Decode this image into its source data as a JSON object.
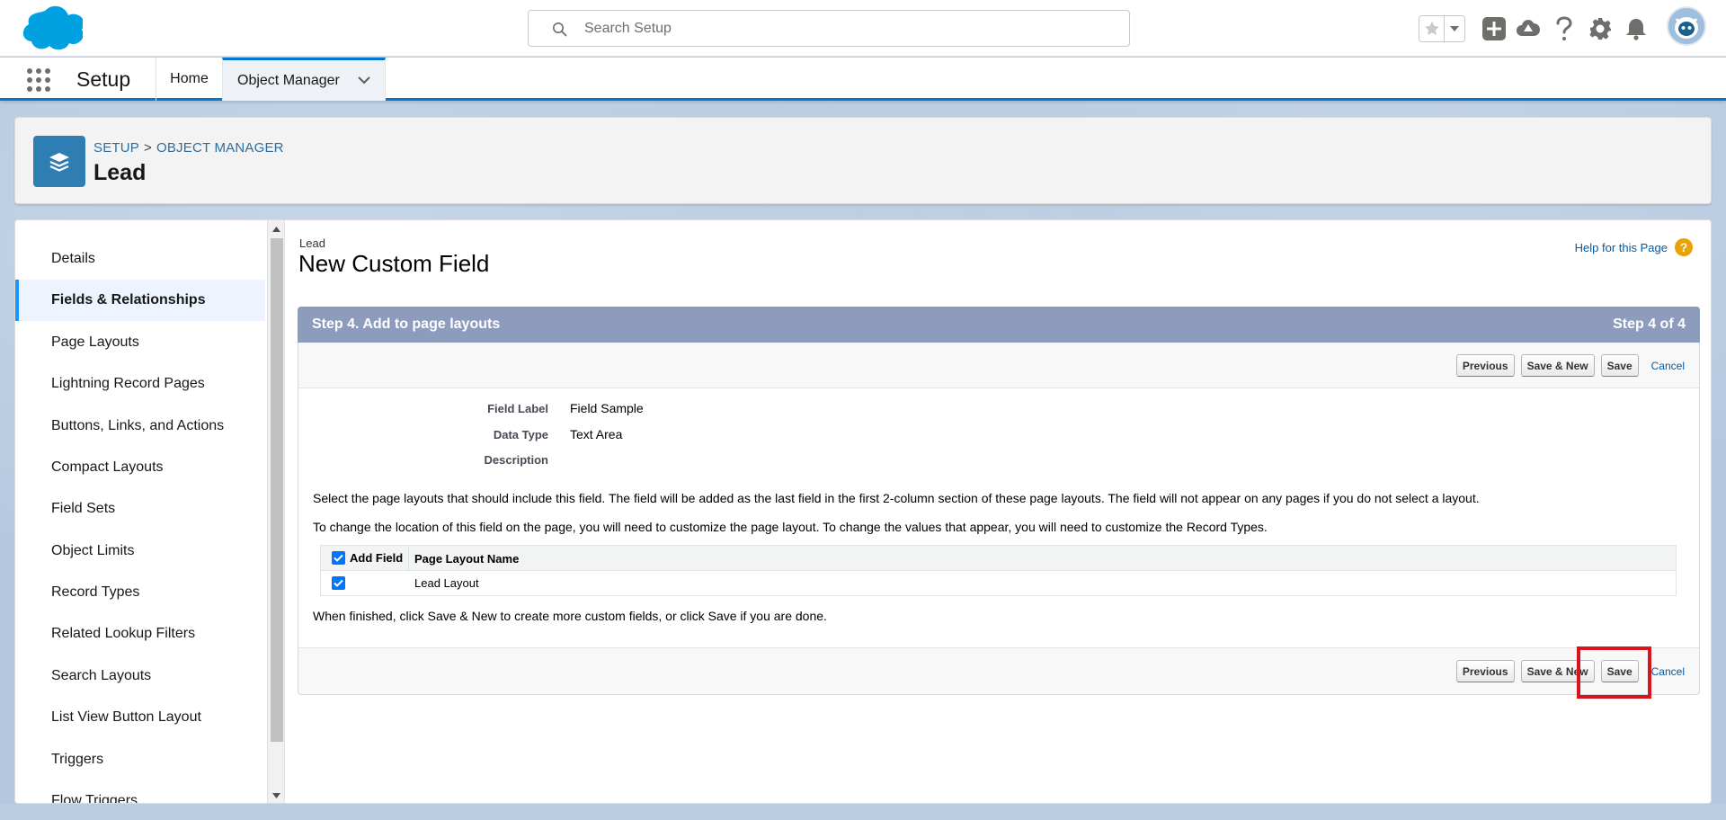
{
  "header": {
    "search_placeholder": "Search Setup"
  },
  "app_nav": {
    "app_name": "Setup",
    "tabs": [
      {
        "label": "Home"
      },
      {
        "label": "Object Manager"
      }
    ]
  },
  "page_header": {
    "breadcrumb": [
      "SETUP",
      "OBJECT MANAGER"
    ],
    "breadcrumb_separator": ">",
    "title": "Lead"
  },
  "sidebar": {
    "items": [
      {
        "label": "Details"
      },
      {
        "label": "Fields & Relationships"
      },
      {
        "label": "Page Layouts"
      },
      {
        "label": "Lightning Record Pages"
      },
      {
        "label": "Buttons, Links, and Actions"
      },
      {
        "label": "Compact Layouts"
      },
      {
        "label": "Field Sets"
      },
      {
        "label": "Object Limits"
      },
      {
        "label": "Record Types"
      },
      {
        "label": "Related Lookup Filters"
      },
      {
        "label": "Search Layouts"
      },
      {
        "label": "List View Button Layout"
      },
      {
        "label": "Triggers"
      },
      {
        "label": "Flow Triggers"
      }
    ],
    "active_index": 1
  },
  "content": {
    "object_name": "Lead",
    "title": "New Custom Field",
    "help_link": "Help for this Page",
    "wizard": {
      "step_title": "Step 4. Add to page layouts",
      "step_count": "Step 4 of 4",
      "buttons": {
        "previous": "Previous",
        "save_new": "Save & New",
        "save": "Save",
        "cancel": "Cancel"
      },
      "details": [
        {
          "label": "Field Label",
          "value": "Field Sample"
        },
        {
          "label": "Data Type",
          "value": "Text Area"
        },
        {
          "label": "Description",
          "value": ""
        }
      ],
      "info_1": "Select the page layouts that should include this field. The field will be added as the last field in the first 2-column section of these page layouts. The field will not appear on any pages if you do not select a layout.",
      "info_2": "To change the location of this field on the page, you will need to customize the page layout. To change the values that appear, you will need to customize the Record Types.",
      "table": {
        "headers": [
          "Add Field",
          "Page Layout Name"
        ],
        "rows": [
          {
            "checked": true,
            "name": "Lead Layout"
          }
        ]
      },
      "finish_text": "When finished, click Save & New to create more custom fields, or click Save if you are done."
    }
  },
  "colors": {
    "brand_blue": "#0176d3",
    "salesforce_cloud": "#00a1e0",
    "wizard_bar": "#8d9cbd",
    "highlight": "#d9141f"
  }
}
